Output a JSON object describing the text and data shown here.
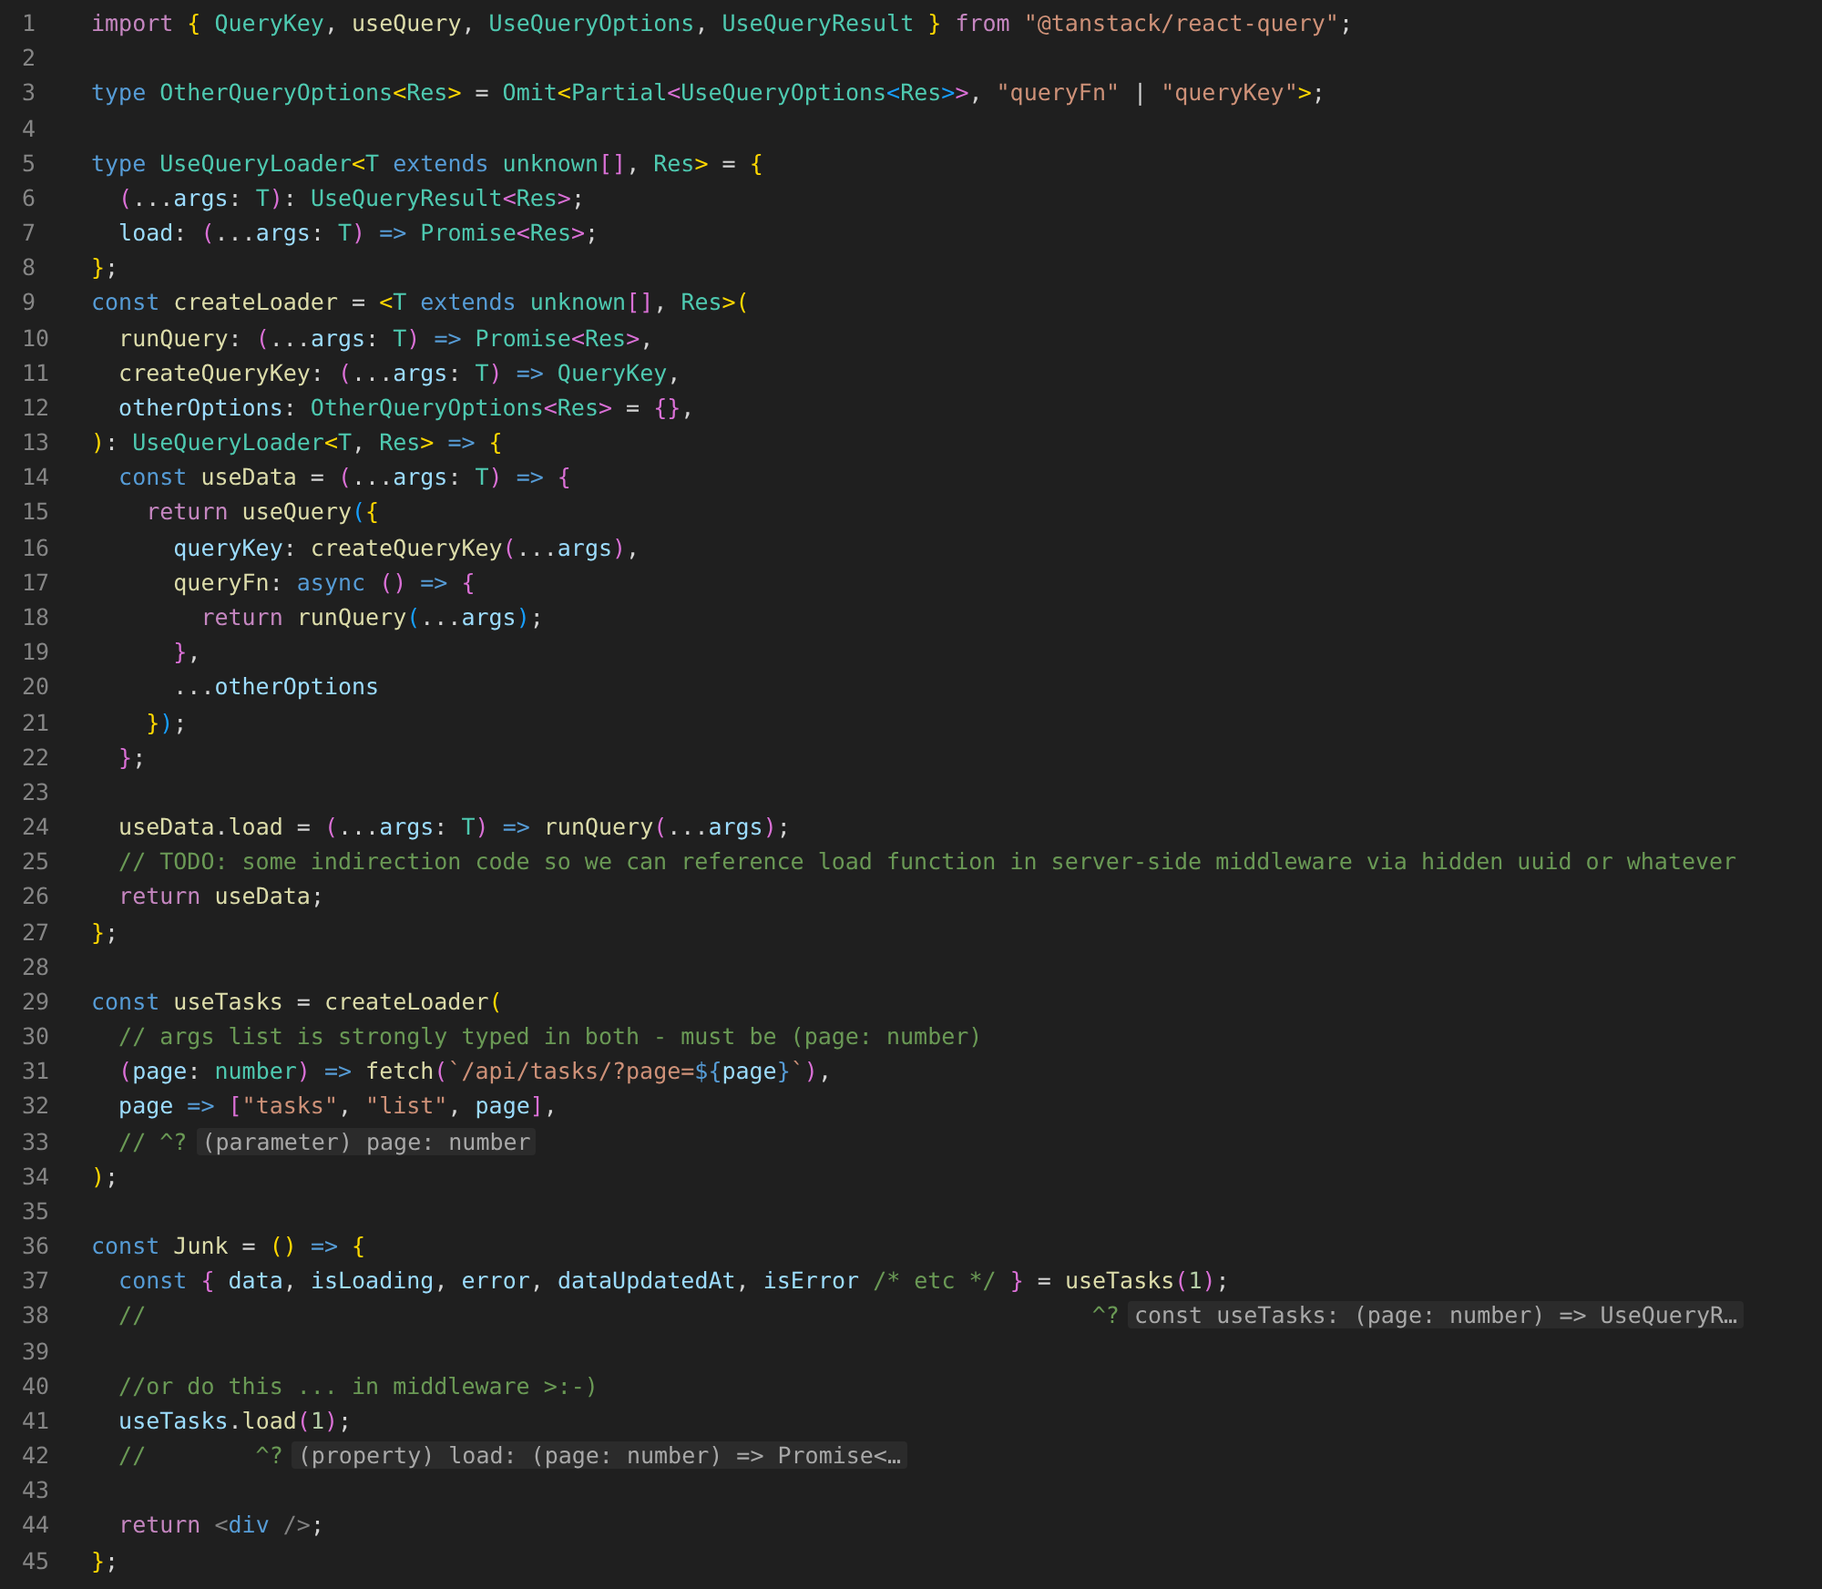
{
  "editor": {
    "lines": [
      {
        "number": "1",
        "tokens": [
          {
            "kind": "c",
            "text": "import"
          },
          {
            "kind": "b1",
            "text": " {"
          },
          {
            "kind": "t",
            "text": " QueryKey"
          },
          {
            "kind": "p",
            "text": ", "
          },
          {
            "kind": "f",
            "text": "useQuery"
          },
          {
            "kind": "p",
            "text": ", "
          },
          {
            "kind": "t",
            "text": "UseQueryOptions"
          },
          {
            "kind": "p",
            "text": ", "
          },
          {
            "kind": "t",
            "text": "UseQueryResult"
          },
          {
            "kind": "b1",
            "text": " }"
          },
          {
            "kind": "c",
            "text": " from"
          },
          {
            "kind": "s",
            "text": " \"@tanstack/react-query\""
          },
          {
            "kind": "p",
            "text": ";"
          }
        ]
      },
      {
        "number": "2"
      },
      {
        "number": "3",
        "tokens": [
          {
            "kind": "k",
            "text": "type"
          },
          {
            "kind": "t",
            "text": " OtherQueryOptions"
          },
          {
            "kind": "b1",
            "text": "<"
          },
          {
            "kind": "t",
            "text": "Res"
          },
          {
            "kind": "b1",
            "text": ">"
          },
          {
            "kind": "p",
            "text": " = "
          },
          {
            "kind": "t",
            "text": "Omit"
          },
          {
            "kind": "b1",
            "text": "<"
          },
          {
            "kind": "t",
            "text": "Partial"
          },
          {
            "kind": "b2",
            "text": "<"
          },
          {
            "kind": "t",
            "text": "UseQueryOptions"
          },
          {
            "kind": "b3",
            "text": "<"
          },
          {
            "kind": "t",
            "text": "Res"
          },
          {
            "kind": "b3",
            "text": ">"
          },
          {
            "kind": "b2",
            "text": ">"
          },
          {
            "kind": "p",
            "text": ", "
          },
          {
            "kind": "s",
            "text": "\"queryFn\""
          },
          {
            "kind": "p",
            "text": " | "
          },
          {
            "kind": "s",
            "text": "\"queryKey\""
          },
          {
            "kind": "b1",
            "text": ">"
          },
          {
            "kind": "p",
            "text": ";"
          }
        ]
      },
      {
        "number": "4"
      },
      {
        "number": "5",
        "tokens": [
          {
            "kind": "k",
            "text": "type"
          },
          {
            "kind": "t",
            "text": " UseQueryLoader"
          },
          {
            "kind": "b1",
            "text": "<"
          },
          {
            "kind": "t",
            "text": "T"
          },
          {
            "kind": "k",
            "text": " extends"
          },
          {
            "kind": "t",
            "text": " unknown"
          },
          {
            "kind": "b2",
            "text": "[]"
          },
          {
            "kind": "p",
            "text": ", "
          },
          {
            "kind": "t",
            "text": "Res"
          },
          {
            "kind": "b1",
            "text": ">"
          },
          {
            "kind": "p",
            "text": " = "
          },
          {
            "kind": "b1",
            "text": "{"
          }
        ]
      },
      {
        "number": "6",
        "tokens": [
          {
            "kind": "b2",
            "text": "  ("
          },
          {
            "kind": "p",
            "text": "..."
          },
          {
            "kind": "v",
            "text": "args"
          },
          {
            "kind": "p",
            "text": ": "
          },
          {
            "kind": "t",
            "text": "T"
          },
          {
            "kind": "b2",
            "text": ")"
          },
          {
            "kind": "p",
            "text": ": "
          },
          {
            "kind": "t",
            "text": "UseQueryResult"
          },
          {
            "kind": "b2",
            "text": "<"
          },
          {
            "kind": "t",
            "text": "Res"
          },
          {
            "kind": "b2",
            "text": ">"
          },
          {
            "kind": "p",
            "text": ";"
          }
        ]
      },
      {
        "number": "7",
        "tokens": [
          {
            "kind": "v",
            "text": "  load"
          },
          {
            "kind": "p",
            "text": ": "
          },
          {
            "kind": "b2",
            "text": "("
          },
          {
            "kind": "p",
            "text": "..."
          },
          {
            "kind": "v",
            "text": "args"
          },
          {
            "kind": "p",
            "text": ": "
          },
          {
            "kind": "t",
            "text": "T"
          },
          {
            "kind": "b2",
            "text": ")"
          },
          {
            "kind": "k",
            "text": " =>"
          },
          {
            "kind": "t",
            "text": " Promise"
          },
          {
            "kind": "b2",
            "text": "<"
          },
          {
            "kind": "t",
            "text": "Res"
          },
          {
            "kind": "b2",
            "text": ">"
          },
          {
            "kind": "p",
            "text": ";"
          }
        ]
      },
      {
        "number": "8",
        "tokens": [
          {
            "kind": "b1",
            "text": "}"
          },
          {
            "kind": "p",
            "text": ";"
          }
        ]
      },
      {
        "number": "9",
        "tokens": [
          {
            "kind": "k",
            "text": "const"
          },
          {
            "kind": "f",
            "text": " createLoader"
          },
          {
            "kind": "p",
            "text": " = "
          },
          {
            "kind": "b1",
            "text": "<"
          },
          {
            "kind": "t",
            "text": "T"
          },
          {
            "kind": "k",
            "text": " extends"
          },
          {
            "kind": "t",
            "text": " unknown"
          },
          {
            "kind": "b2",
            "text": "[]"
          },
          {
            "kind": "p",
            "text": ", "
          },
          {
            "kind": "t",
            "text": "Res"
          },
          {
            "kind": "b1",
            "text": ">("
          }
        ]
      },
      {
        "number": "10",
        "tokens": [
          {
            "kind": "f",
            "text": "  runQuery"
          },
          {
            "kind": "p",
            "text": ": "
          },
          {
            "kind": "b2",
            "text": "("
          },
          {
            "kind": "p",
            "text": "..."
          },
          {
            "kind": "v",
            "text": "args"
          },
          {
            "kind": "p",
            "text": ": "
          },
          {
            "kind": "t",
            "text": "T"
          },
          {
            "kind": "b2",
            "text": ")"
          },
          {
            "kind": "k",
            "text": " =>"
          },
          {
            "kind": "t",
            "text": " Promise"
          },
          {
            "kind": "b2",
            "text": "<"
          },
          {
            "kind": "t",
            "text": "Res"
          },
          {
            "kind": "b2",
            "text": ">"
          },
          {
            "kind": "p",
            "text": ","
          }
        ]
      },
      {
        "number": "11",
        "tokens": [
          {
            "kind": "f",
            "text": "  createQueryKey"
          },
          {
            "kind": "p",
            "text": ": "
          },
          {
            "kind": "b2",
            "text": "("
          },
          {
            "kind": "p",
            "text": "..."
          },
          {
            "kind": "v",
            "text": "args"
          },
          {
            "kind": "p",
            "text": ": "
          },
          {
            "kind": "t",
            "text": "T"
          },
          {
            "kind": "b2",
            "text": ")"
          },
          {
            "kind": "k",
            "text": " =>"
          },
          {
            "kind": "t",
            "text": " QueryKey"
          },
          {
            "kind": "p",
            "text": ","
          }
        ]
      },
      {
        "number": "12",
        "tokens": [
          {
            "kind": "v",
            "text": "  otherOptions"
          },
          {
            "kind": "p",
            "text": ": "
          },
          {
            "kind": "t",
            "text": "OtherQueryOptions"
          },
          {
            "kind": "b2",
            "text": "<"
          },
          {
            "kind": "t",
            "text": "Res"
          },
          {
            "kind": "b2",
            "text": ">"
          },
          {
            "kind": "p",
            "text": " = "
          },
          {
            "kind": "b2",
            "text": "{}"
          },
          {
            "kind": "p",
            "text": ","
          }
        ]
      },
      {
        "number": "13",
        "tokens": [
          {
            "kind": "b1",
            "text": ")"
          },
          {
            "kind": "p",
            "text": ": "
          },
          {
            "kind": "t",
            "text": "UseQueryLoader"
          },
          {
            "kind": "b1",
            "text": "<"
          },
          {
            "kind": "t",
            "text": "T"
          },
          {
            "kind": "p",
            "text": ", "
          },
          {
            "kind": "t",
            "text": "Res"
          },
          {
            "kind": "b1",
            "text": ">"
          },
          {
            "kind": "k",
            "text": " =>"
          },
          {
            "kind": "b1",
            "text": " {"
          }
        ]
      },
      {
        "number": "14",
        "tokens": [
          {
            "kind": "k",
            "text": "  const"
          },
          {
            "kind": "f",
            "text": " useData"
          },
          {
            "kind": "p",
            "text": " = "
          },
          {
            "kind": "b2",
            "text": "("
          },
          {
            "kind": "p",
            "text": "..."
          },
          {
            "kind": "v",
            "text": "args"
          },
          {
            "kind": "p",
            "text": ": "
          },
          {
            "kind": "t",
            "text": "T"
          },
          {
            "kind": "b2",
            "text": ")"
          },
          {
            "kind": "k",
            "text": " =>"
          },
          {
            "kind": "b2",
            "text": " {"
          }
        ]
      },
      {
        "number": "15",
        "tokens": [
          {
            "kind": "c",
            "text": "    return"
          },
          {
            "kind": "f",
            "text": " useQuery"
          },
          {
            "kind": "b3",
            "text": "("
          },
          {
            "kind": "b1",
            "text": "{"
          }
        ]
      },
      {
        "number": "16",
        "tokens": [
          {
            "kind": "v",
            "text": "      queryKey"
          },
          {
            "kind": "p",
            "text": ": "
          },
          {
            "kind": "f",
            "text": "createQueryKey"
          },
          {
            "kind": "b2",
            "text": "("
          },
          {
            "kind": "p",
            "text": "..."
          },
          {
            "kind": "v",
            "text": "args"
          },
          {
            "kind": "b2",
            "text": ")"
          },
          {
            "kind": "p",
            "text": ","
          }
        ]
      },
      {
        "number": "17",
        "tokens": [
          {
            "kind": "f",
            "text": "      queryFn"
          },
          {
            "kind": "p",
            "text": ": "
          },
          {
            "kind": "k",
            "text": "async"
          },
          {
            "kind": "b2",
            "text": " ()"
          },
          {
            "kind": "k",
            "text": " =>"
          },
          {
            "kind": "b2",
            "text": " {"
          }
        ]
      },
      {
        "number": "18",
        "tokens": [
          {
            "kind": "c",
            "text": "        return"
          },
          {
            "kind": "f",
            "text": " runQuery"
          },
          {
            "kind": "b3",
            "text": "("
          },
          {
            "kind": "p",
            "text": "..."
          },
          {
            "kind": "v",
            "text": "args"
          },
          {
            "kind": "b3",
            "text": ")"
          },
          {
            "kind": "p",
            "text": ";"
          }
        ]
      },
      {
        "number": "19",
        "tokens": [
          {
            "kind": "b2",
            "text": "      }"
          },
          {
            "kind": "p",
            "text": ","
          }
        ]
      },
      {
        "number": "20",
        "tokens": [
          {
            "kind": "p",
            "text": "      ..."
          },
          {
            "kind": "v",
            "text": "otherOptions"
          }
        ]
      },
      {
        "number": "21",
        "tokens": [
          {
            "kind": "b1",
            "text": "    }"
          },
          {
            "kind": "b3",
            "text": ")"
          },
          {
            "kind": "p",
            "text": ";"
          }
        ]
      },
      {
        "number": "22",
        "tokens": [
          {
            "kind": "b2",
            "text": "  }"
          },
          {
            "kind": "p",
            "text": ";"
          }
        ]
      },
      {
        "number": "23"
      },
      {
        "number": "24",
        "tokens": [
          {
            "kind": "f",
            "text": "  useData"
          },
          {
            "kind": "p",
            "text": "."
          },
          {
            "kind": "f",
            "text": "load"
          },
          {
            "kind": "p",
            "text": " = "
          },
          {
            "kind": "b2",
            "text": "("
          },
          {
            "kind": "p",
            "text": "..."
          },
          {
            "kind": "v",
            "text": "args"
          },
          {
            "kind": "p",
            "text": ": "
          },
          {
            "kind": "t",
            "text": "T"
          },
          {
            "kind": "b2",
            "text": ")"
          },
          {
            "kind": "k",
            "text": " =>"
          },
          {
            "kind": "f",
            "text": " runQuery"
          },
          {
            "kind": "b2",
            "text": "("
          },
          {
            "kind": "p",
            "text": "..."
          },
          {
            "kind": "v",
            "text": "args"
          },
          {
            "kind": "b2",
            "text": ")"
          },
          {
            "kind": "p",
            "text": ";"
          }
        ]
      },
      {
        "number": "25",
        "tokens": [
          {
            "kind": "m",
            "text": "  // TODO: some indirection code so we can reference load function in server-side middleware via hidden uuid or whatever"
          }
        ]
      },
      {
        "number": "26",
        "tokens": [
          {
            "kind": "c",
            "text": "  return"
          },
          {
            "kind": "f",
            "text": " useData"
          },
          {
            "kind": "p",
            "text": ";"
          }
        ]
      },
      {
        "number": "27",
        "tokens": [
          {
            "kind": "b1",
            "text": "}"
          },
          {
            "kind": "p",
            "text": ";"
          }
        ]
      },
      {
        "number": "28"
      },
      {
        "number": "29",
        "tokens": [
          {
            "kind": "k",
            "text": "const"
          },
          {
            "kind": "f",
            "text": " useTasks"
          },
          {
            "kind": "p",
            "text": " = "
          },
          {
            "kind": "f",
            "text": "createLoader"
          },
          {
            "kind": "b1",
            "text": "("
          }
        ]
      },
      {
        "number": "30",
        "tokens": [
          {
            "kind": "m",
            "text": "  // args list is strongly typed in both - must be (page: number)"
          }
        ]
      },
      {
        "number": "31",
        "tokens": [
          {
            "kind": "b2",
            "text": "  ("
          },
          {
            "kind": "v",
            "text": "page"
          },
          {
            "kind": "p",
            "text": ": "
          },
          {
            "kind": "t",
            "text": "number"
          },
          {
            "kind": "b2",
            "text": ")"
          },
          {
            "kind": "k",
            "text": " =>"
          },
          {
            "kind": "f",
            "text": " fetch"
          },
          {
            "kind": "b2",
            "text": "("
          },
          {
            "kind": "s",
            "text": "`/api/tasks/?page="
          },
          {
            "kind": "k",
            "text": "${"
          },
          {
            "kind": "v",
            "text": "page"
          },
          {
            "kind": "k",
            "text": "}"
          },
          {
            "kind": "s",
            "text": "`"
          },
          {
            "kind": "b2",
            "text": ")"
          },
          {
            "kind": "p",
            "text": ","
          }
        ]
      },
      {
        "number": "32",
        "tokens": [
          {
            "kind": "v",
            "text": "  page"
          },
          {
            "kind": "k",
            "text": " =>"
          },
          {
            "kind": "b2",
            "text": " ["
          },
          {
            "kind": "s",
            "text": "\"tasks\""
          },
          {
            "kind": "p",
            "text": ", "
          },
          {
            "kind": "s",
            "text": "\"list\""
          },
          {
            "kind": "p",
            "text": ", "
          },
          {
            "kind": "v",
            "text": "page"
          },
          {
            "kind": "b2",
            "text": "]"
          },
          {
            "kind": "p",
            "text": ","
          }
        ]
      },
      {
        "number": "33",
        "tokens": [
          {
            "kind": "m",
            "text": "  // ^?"
          }
        ],
        "hint": "(parameter) page: number"
      },
      {
        "number": "34",
        "tokens": [
          {
            "kind": "b1",
            "text": ")"
          },
          {
            "kind": "p",
            "text": ";"
          }
        ]
      },
      {
        "number": "35"
      },
      {
        "number": "36",
        "tokens": [
          {
            "kind": "k",
            "text": "const"
          },
          {
            "kind": "f",
            "text": " Junk"
          },
          {
            "kind": "p",
            "text": " = "
          },
          {
            "kind": "b1",
            "text": "()"
          },
          {
            "kind": "k",
            "text": " =>"
          },
          {
            "kind": "b1",
            "text": " {"
          }
        ]
      },
      {
        "number": "37",
        "tokens": [
          {
            "kind": "k",
            "text": "  const"
          },
          {
            "kind": "b2",
            "text": " {"
          },
          {
            "kind": "v",
            "text": " data"
          },
          {
            "kind": "p",
            "text": ", "
          },
          {
            "kind": "v",
            "text": "isLoading"
          },
          {
            "kind": "p",
            "text": ", "
          },
          {
            "kind": "v",
            "text": "error"
          },
          {
            "kind": "p",
            "text": ", "
          },
          {
            "kind": "v",
            "text": "dataUpdatedAt"
          },
          {
            "kind": "p",
            "text": ", "
          },
          {
            "kind": "v",
            "text": "isError"
          },
          {
            "kind": "m",
            "text": " /* etc */"
          },
          {
            "kind": "b2",
            "text": " }"
          },
          {
            "kind": "p",
            "text": " = "
          },
          {
            "kind": "f",
            "text": "useTasks"
          },
          {
            "kind": "b2",
            "text": "("
          },
          {
            "kind": "n",
            "text": "1"
          },
          {
            "kind": "b2",
            "text": ")"
          },
          {
            "kind": "p",
            "text": ";"
          }
        ]
      },
      {
        "number": "38",
        "tokens": [
          {
            "kind": "m",
            "text": "  //                                                                     ^?"
          }
        ],
        "hint": "const useTasks: (page: number) => UseQueryR…"
      },
      {
        "number": "39"
      },
      {
        "number": "40",
        "tokens": [
          {
            "kind": "m",
            "text": "  //or do this ... in middleware >:-)"
          }
        ]
      },
      {
        "number": "41",
        "tokens": [
          {
            "kind": "v",
            "text": "  useTasks"
          },
          {
            "kind": "p",
            "text": "."
          },
          {
            "kind": "f",
            "text": "load"
          },
          {
            "kind": "b2",
            "text": "("
          },
          {
            "kind": "n",
            "text": "1"
          },
          {
            "kind": "b2",
            "text": ")"
          },
          {
            "kind": "p",
            "text": ";"
          }
        ]
      },
      {
        "number": "42",
        "tokens": [
          {
            "kind": "m",
            "text": "  //        ^?"
          }
        ],
        "hint": "(property) load: (page: number) => Promise<…"
      },
      {
        "number": "43"
      },
      {
        "number": "44",
        "tokens": [
          {
            "kind": "c",
            "text": "  return"
          },
          {
            "kind": "g",
            "text": " <"
          },
          {
            "kind": "k",
            "text": "div"
          },
          {
            "kind": "g",
            "text": " />"
          },
          {
            "kind": "p",
            "text": ";"
          }
        ]
      },
      {
        "number": "45",
        "tokens": [
          {
            "kind": "b1",
            "text": "}"
          },
          {
            "kind": "p",
            "text": ";"
          }
        ]
      }
    ]
  }
}
